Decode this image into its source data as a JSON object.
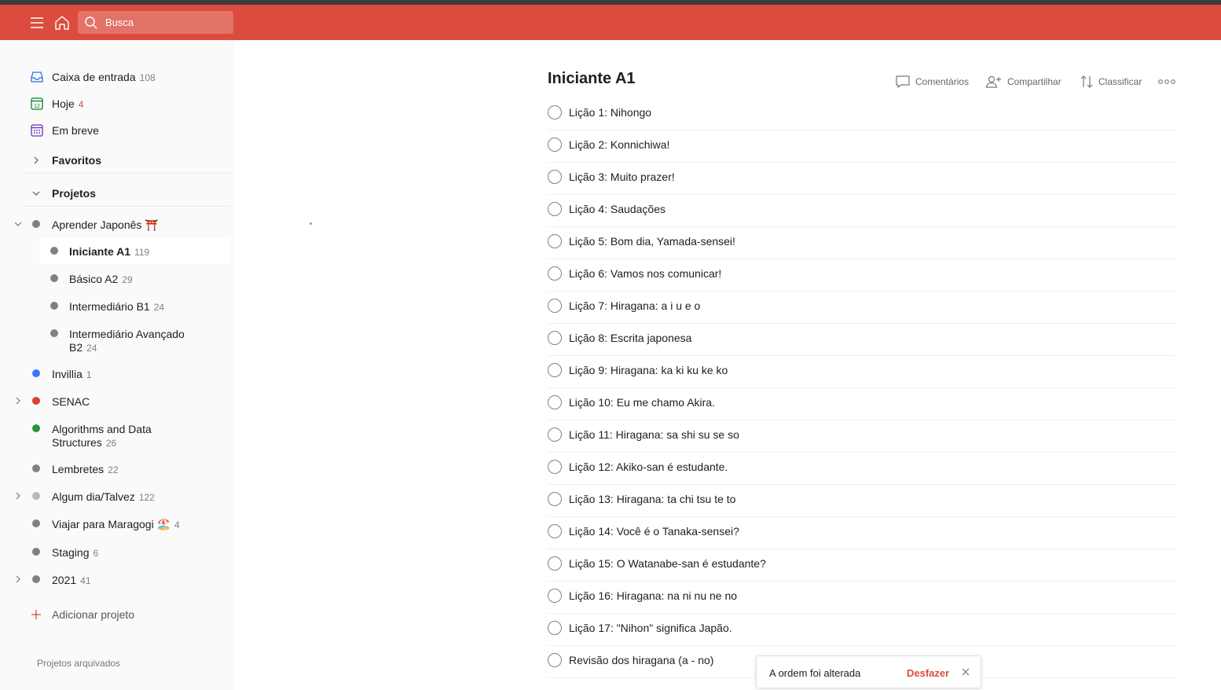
{
  "topbar": {
    "menu_icon": "hamburger-icon",
    "home_icon": "home-icon",
    "search_placeholder": "Busca",
    "color": "#db4c3f"
  },
  "sidebar": {
    "inbox": {
      "label": "Caixa de entrada",
      "count": "108"
    },
    "today": {
      "label": "Hoje",
      "count": "4"
    },
    "upcoming": {
      "label": "Em breve"
    },
    "favorites": "Favoritos",
    "projects": "Projetos",
    "project_list": [
      {
        "label": "Aprender Japonês ⛩️",
        "count": "",
        "color": "#808080"
      },
      {
        "label": "Iniciante A1",
        "count": "119",
        "color": "#808080"
      },
      {
        "label": "Básico A2",
        "count": "29",
        "color": "#808080"
      },
      {
        "label": "Intermediário B1",
        "count": "24",
        "color": "#808080"
      },
      {
        "label": "Intermediário Avançado",
        "label2": "B2",
        "count": "24",
        "color": "#808080"
      },
      {
        "label": "Invillia",
        "count": "1",
        "color": "#4073ff"
      },
      {
        "label": "SENAC",
        "count": "",
        "color": "#db4035"
      },
      {
        "label": "Algorithms and Data",
        "label2": "Structures",
        "count": "26",
        "color": "#299438"
      },
      {
        "label": "Lembretes",
        "count": "22",
        "color": "#808080"
      },
      {
        "label": "Algum dia/Talvez",
        "count": "122",
        "color": "#b8b8b8"
      },
      {
        "label": "Viajar para Maragogi 🏖️",
        "count": "4",
        "color": "#808080"
      },
      {
        "label": "Staging",
        "count": "6",
        "color": "#808080"
      },
      {
        "label": "2021",
        "count": "41",
        "color": "#808080"
      }
    ],
    "add_project": "Adicionar projeto",
    "archived": "Projetos arquivados"
  },
  "main": {
    "title": "Iniciante A1",
    "comments": "Comentários",
    "share": "Compartilhar",
    "sort": "Classificar",
    "more_icon": "more-icon",
    "tasks": [
      "Lição 1: Nihongo",
      "Lição 2: Konnichiwa!",
      "Lição 3: Muito prazer!",
      "Lição 4: Saudações",
      "Lição 5: Bom dia, Yamada-sensei!",
      "Lição 6: Vamos nos comunicar!",
      "Lição 7: Hiragana: a i u e o",
      "Lição 8: Escrita japonesa",
      "Lição 9: Hiragana: ka ki ku ke ko",
      "Lição 10: Eu me chamo Akira.",
      "Lição 11: Hiragana: sa shi su se so",
      "Lição 12: Akiko-san é estudante.",
      "Lição 13: Hiragana: ta chi tsu te to",
      "Lição 14: Você é o Tanaka-sensei?",
      "Lição 15: O Watanabe-san é estudante?",
      "Lição 16: Hiragana: na ni nu ne no",
      "Lição 17: \"Nihon\" significa Japão.",
      "Revisão dos hiragana (a - no)"
    ]
  },
  "toast": {
    "message": "A ordem foi alterada",
    "undo": "Desfazer"
  }
}
